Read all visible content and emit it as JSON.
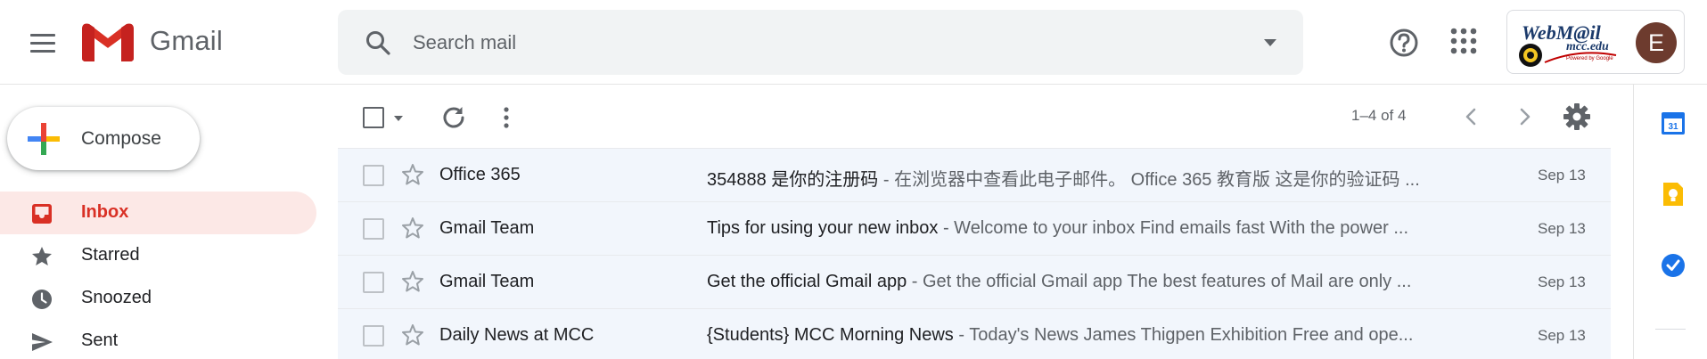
{
  "header": {
    "app_name": "Gmail",
    "search_placeholder": "Search mail",
    "org": {
      "title": "WebM@il",
      "domain": "mcc.edu",
      "powered": "Powered by Google"
    },
    "avatar_initial": "E"
  },
  "compose": {
    "label": "Compose"
  },
  "nav": {
    "items": [
      {
        "label": "Inbox",
        "icon": "inbox-icon",
        "active": true
      },
      {
        "label": "Starred",
        "icon": "star-icon",
        "active": false
      },
      {
        "label": "Snoozed",
        "icon": "clock-icon",
        "active": false
      },
      {
        "label": "Sent",
        "icon": "send-icon",
        "active": false
      }
    ]
  },
  "toolbar": {
    "page_info": "1–4 of 4"
  },
  "messages": [
    {
      "sender": "Office 365",
      "subject": "354888 是你的注册码",
      "separator": " - ",
      "snippet": "在浏览器中查看此电子邮件。 Office 365 教育版 这是你的验证码 ...",
      "date": "Sep 13"
    },
    {
      "sender": "Gmail Team",
      "subject": "Tips for using your new inbox",
      "separator": " - ",
      "snippet": "Welcome to your inbox Find emails fast With the power ...",
      "date": "Sep 13"
    },
    {
      "sender": "Gmail Team",
      "subject": "Get the official Gmail app",
      "separator": " - ",
      "snippet": "Get the official Gmail app The best features of Mail are only ...",
      "date": "Sep 13"
    },
    {
      "sender": "Daily News at MCC",
      "subject": "{Students} MCC Morning News",
      "separator": " - ",
      "snippet": "Today's News James Thigpen Exhibition Free and ope...",
      "date": "Sep 13"
    }
  ],
  "side_panel": {
    "calendar_day": "31",
    "icons": [
      "calendar-icon",
      "keep-icon",
      "tasks-icon"
    ]
  },
  "colors": {
    "accent_red": "#d93025",
    "active_bg": "#fce8e6",
    "row_bg": "#f2f6fc",
    "avatar_bg": "#6d3b2e"
  }
}
